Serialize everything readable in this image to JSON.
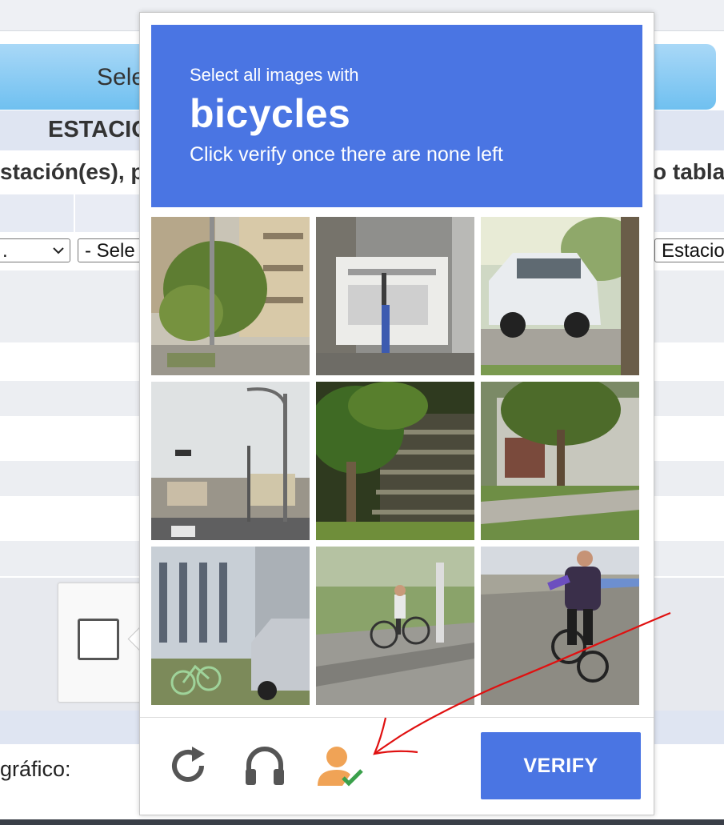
{
  "background_page": {
    "banner_text": "Sele",
    "section_title": "ESTACIO",
    "left_row_text": "stación(es), p",
    "right_row_text": "o tabla",
    "select_left_value": ".",
    "select_mid_value": "- Sele",
    "select_right_value": "Estacio",
    "captcha_checkbox_checked": false,
    "grafico_label": "gráfico:"
  },
  "challenge": {
    "instruction_small": "Select all images with",
    "target_word": "bicycles",
    "instruction_sub": "Click verify once there are none left",
    "tiles": [
      {
        "subject": "street-corner-building-tree"
      },
      {
        "subject": "sign-board-pole"
      },
      {
        "subject": "parked-white-suv"
      },
      {
        "subject": "intersection-traffic-light"
      },
      {
        "subject": "tree-staircase"
      },
      {
        "subject": "house-tree-sidewalk"
      },
      {
        "subject": "building-parked-bicycle-car"
      },
      {
        "subject": "cyclist-on-path"
      },
      {
        "subject": "cyclist-close-up"
      }
    ],
    "footer": {
      "reload_icon": "reload-icon",
      "audio_icon": "headphones-icon",
      "accessibility_icon": "person-check-icon",
      "verify_label": "VERIFY"
    }
  },
  "colors": {
    "accent": "#4a75e3",
    "annotation": "#e01010",
    "icon_gray": "#555555",
    "person_icon": "#f0a356",
    "check_icon": "#3aa04b"
  }
}
